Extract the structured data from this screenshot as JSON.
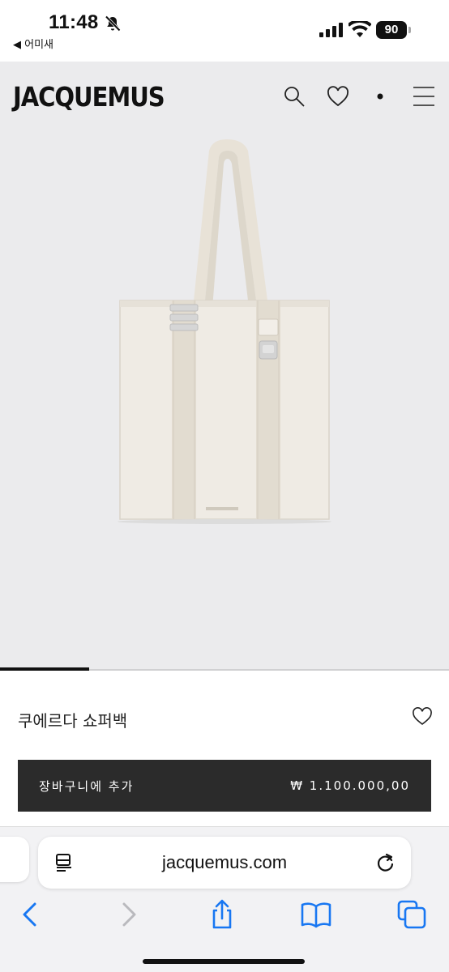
{
  "status_bar": {
    "time": "11:48",
    "back_app_label": "◀ 어미새",
    "battery": "90"
  },
  "header": {
    "logo": "JACQUEMUS"
  },
  "product": {
    "name": "쿠에르다 쇼퍼백",
    "add_to_cart_label": "장바구니에 추가",
    "price": "₩ 1.100.000,00"
  },
  "browser": {
    "url": "jacquemus.com"
  },
  "icons": {
    "search": "search-icon",
    "wishlist": "heart-icon",
    "cart": "dot-icon",
    "menu": "hamburger-menu-icon",
    "reader": "reader-mode-icon",
    "reload": "reload-icon",
    "back": "chevron-left-icon",
    "forward": "chevron-right-icon",
    "share": "share-icon",
    "bookmarks": "book-icon",
    "tabs": "tabs-icon"
  },
  "colors": {
    "hero_background": "#ebebed",
    "button_background": "#2b2b2b",
    "accent_blue": "#1877f2"
  }
}
